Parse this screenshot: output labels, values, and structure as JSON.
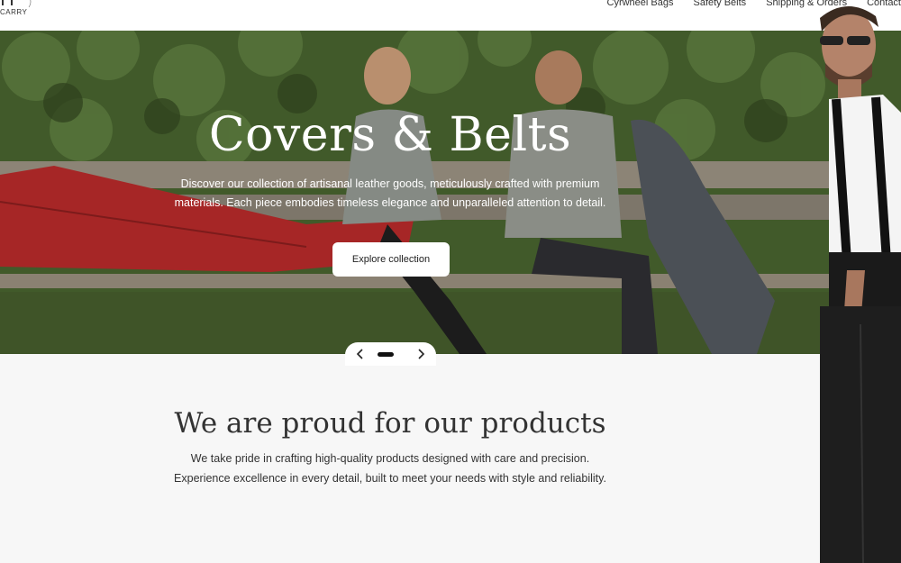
{
  "header": {
    "logo_text": "CARRY",
    "nav": [
      "Cyrwheel Bags",
      "Safety Belts",
      "Shipping & Orders",
      "Contact"
    ]
  },
  "hero": {
    "title": "Covers & Belts",
    "description": "Discover our collection of artisanal leather goods, meticulously crafted with premium materials. Each piece embodies timeless elegance and unparalleled attention to detail.",
    "cta_label": "Explore collection"
  },
  "slider": {
    "prev_icon": "chevron-left-icon",
    "next_icon": "chevron-right-icon"
  },
  "section": {
    "title": "We are proud for our products",
    "line1": "We take pride in crafting high-quality products designed with care and precision.",
    "line2": "Experience excellence in every detail, built to meet your needs with style and reliability."
  },
  "colors": {
    "text_dark": "#333333",
    "button_bg": "#ffffff",
    "page_bg": "#f7f7f7"
  }
}
